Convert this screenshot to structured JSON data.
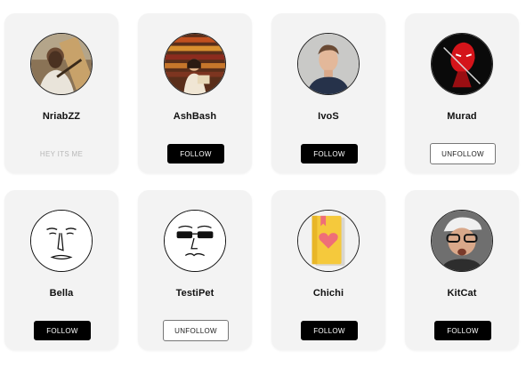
{
  "users": [
    {
      "name": "NriabZZ",
      "status": "HEY ITS ME",
      "button": null,
      "avatar_icon": "man-with-guitar-photo"
    },
    {
      "name": "AshBash",
      "status": null,
      "button": "FOLLOW",
      "avatar_icon": "girl-in-library-photo"
    },
    {
      "name": "IvoS",
      "status": null,
      "button": "FOLLOW",
      "avatar_icon": "man-portrait-photo"
    },
    {
      "name": "Murad",
      "status": null,
      "button": "UNFOLLOW",
      "avatar_icon": "red-ninja-photo"
    },
    {
      "name": "Bella",
      "status": null,
      "button": "FOLLOW",
      "avatar_icon": "sketched-face-icon"
    },
    {
      "name": "TestiPet",
      "status": null,
      "button": "UNFOLLOW",
      "avatar_icon": "sunglasses-face-icon"
    },
    {
      "name": "Chichi",
      "status": null,
      "button": "FOLLOW",
      "avatar_icon": "heart-book-icon"
    },
    {
      "name": "KitCat",
      "status": null,
      "button": "FOLLOW",
      "avatar_icon": "man-with-cap-photo"
    }
  ],
  "colors": {
    "card_bg": "#f3f3f3",
    "follow_bg": "#000000",
    "follow_text": "#ffffff",
    "unfollow_bg": "#ffffff",
    "unfollow_border": "#777777",
    "status_text": "#b8b8b8",
    "book_yellow": "#f5c93c",
    "heart_pink": "#ef6e78"
  }
}
